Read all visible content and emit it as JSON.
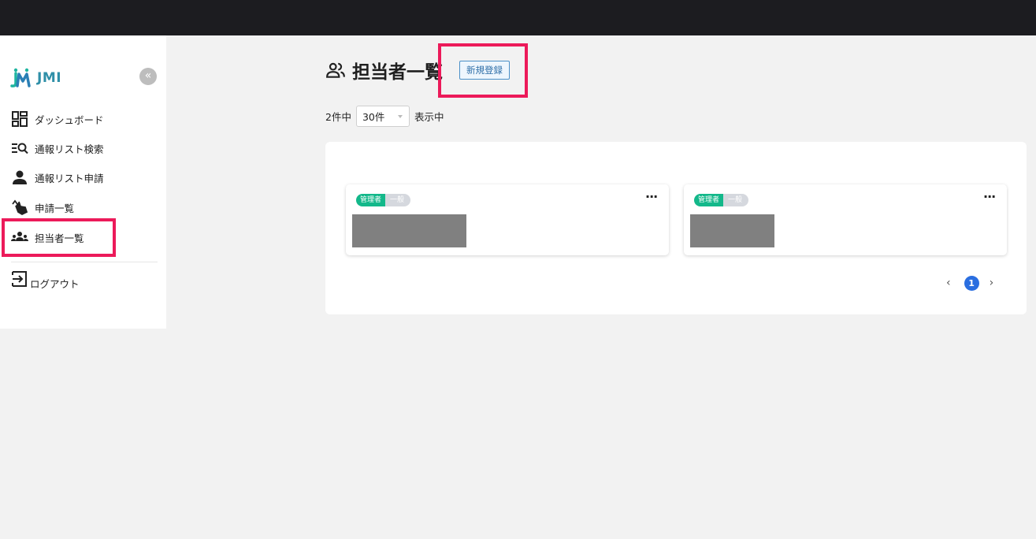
{
  "app": {
    "logo_text": "JMI",
    "collapse_glyph": "«"
  },
  "sidebar": {
    "items": [
      {
        "label": "ダッシュボード",
        "icon": "dashboard-icon"
      },
      {
        "label": "通報リスト検索",
        "icon": "list-search-icon"
      },
      {
        "label": "通報リスト申請",
        "icon": "person-icon"
      },
      {
        "label": "申請一覧",
        "icon": "tap-hand-icon"
      },
      {
        "label": "担当者一覧",
        "icon": "group-icon",
        "active": true
      }
    ],
    "logout": {
      "label": "ログアウト",
      "icon": "logout-icon"
    }
  },
  "main": {
    "title": "担当者一覧",
    "new_button": "新規登録",
    "count_prefix": "2件中",
    "per_page": "30件",
    "count_suffix": "表示中"
  },
  "cards": [
    {
      "badge_role": "管理者",
      "badge_type": "一般",
      "menu": "···"
    },
    {
      "badge_role": "管理者",
      "badge_type": "一般",
      "menu": "···"
    }
  ],
  "pagination": {
    "prev": "‹",
    "current": "1",
    "next": "›"
  },
  "colors": {
    "accent": "#2a6ee0",
    "badge_admin": "#13b88a",
    "highlight": "#ec1a5a",
    "topbar": "#1c1c20"
  }
}
